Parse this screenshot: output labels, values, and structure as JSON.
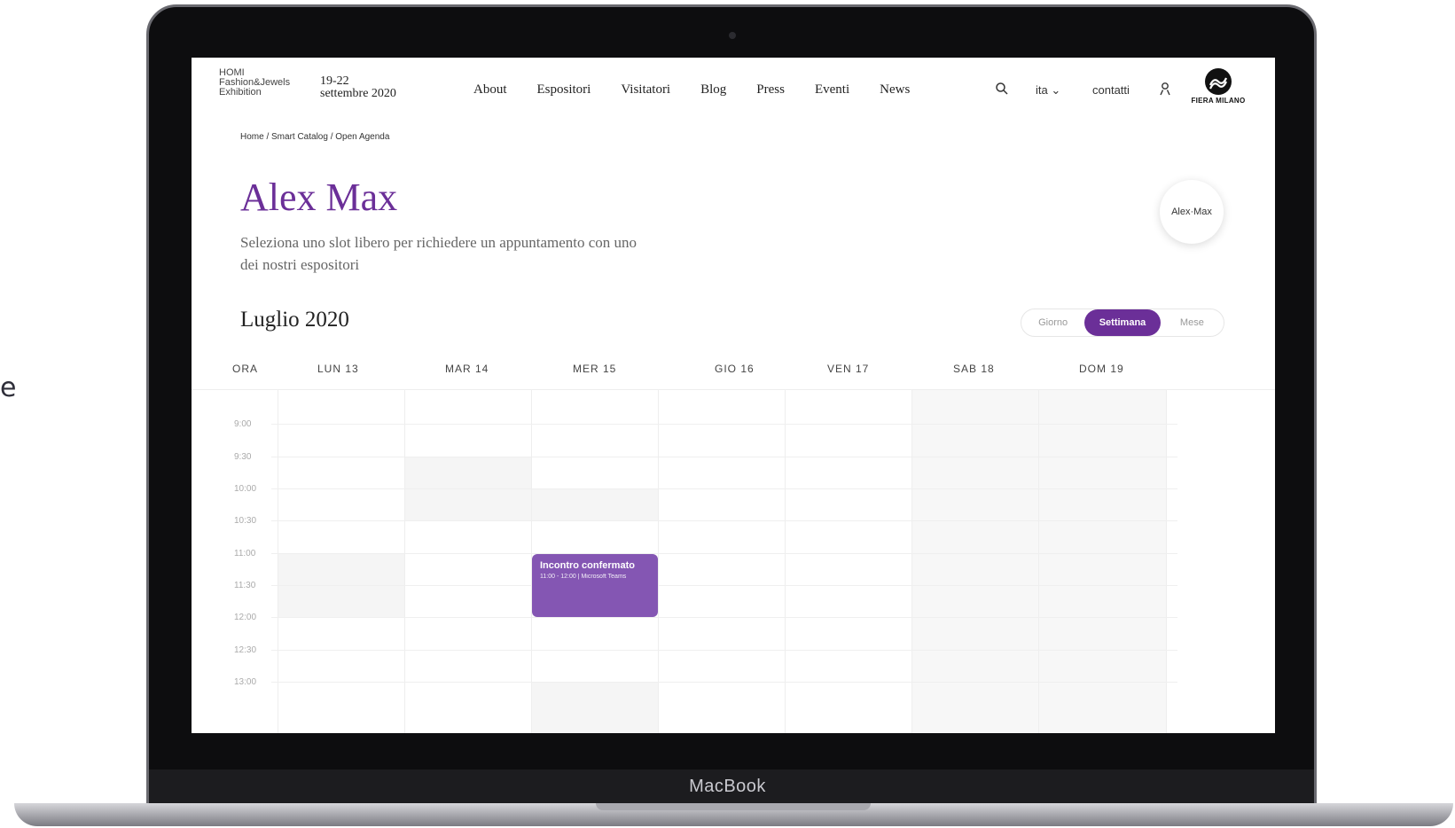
{
  "fragment": {
    "text": "e"
  },
  "device": {
    "brand": "MacBook"
  },
  "header": {
    "logo_lines": [
      "HOMI",
      "Fashion&Jewels",
      "Exhibition"
    ],
    "dates_lines": [
      "19-22",
      "settembre 2020"
    ],
    "nav": [
      "About",
      "Espositori",
      "Visitatori",
      "Blog",
      "Press",
      "Eventi",
      "News"
    ],
    "lang": "ita",
    "contact": "contatti",
    "partner": "FIERA MILANO"
  },
  "breadcrumb": "Home / Smart Catalog / Open Agenda",
  "page": {
    "title": "Alex Max",
    "subtitle": "Seleziona uno slot libero per richiedere un appuntamento con uno dei nostri espositori",
    "avatar": "Alex·Max"
  },
  "calendar": {
    "month": "Luglio 2020",
    "views": [
      "Giorno",
      "Settimana",
      "Mese"
    ],
    "active_view": "Settimana",
    "columns": [
      "ORA",
      "LUN 13",
      "MAR 14",
      "MER 15",
      "GIO 16",
      "VEN 17",
      "SAB 18",
      "DOM 19"
    ],
    "times": [
      "9:00",
      "9:30",
      "10:00",
      "10:30",
      "11:00",
      "11:30",
      "12:00",
      "12:30",
      "13:00"
    ],
    "event": {
      "title": "Incontro confermato",
      "detail": "11:00 - 12:00 | Microsoft Teams"
    }
  },
  "colors": {
    "accent": "#6b2f98",
    "event": "#8456b3"
  }
}
